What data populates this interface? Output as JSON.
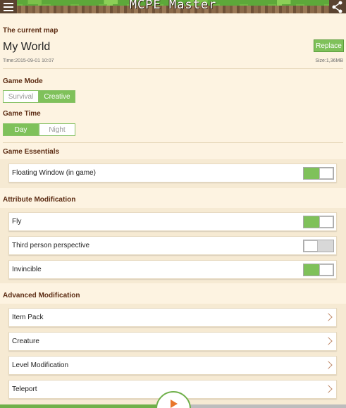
{
  "app": {
    "title": "MCPE Master"
  },
  "current_map": {
    "section_label": "The current map",
    "name": "My World",
    "time": "Time:2015-09-01 10:07",
    "size": "Size:1,36MB",
    "replace_label": "Replace"
  },
  "game_mode": {
    "section_label": "Game Mode",
    "options": [
      "Survival",
      "Creative"
    ],
    "selected": "Creative"
  },
  "game_time": {
    "section_label": "Game Time",
    "options": [
      "Day",
      "Night"
    ],
    "selected": "Day"
  },
  "game_essentials": {
    "section_label": "Game Essentials",
    "items": [
      {
        "label": "Floating Window (in game)",
        "enabled": true
      }
    ]
  },
  "attribute_modification": {
    "section_label": "Attribute Modification",
    "items": [
      {
        "label": "Fly",
        "enabled": true
      },
      {
        "label": "Third person perspective",
        "enabled": false
      },
      {
        "label": "Invincible",
        "enabled": true
      }
    ]
  },
  "advanced_modification": {
    "section_label": "Advanced Modification",
    "items": [
      {
        "label": "Item Pack"
      },
      {
        "label": "Creature"
      },
      {
        "label": "Level Modification"
      },
      {
        "label": "Teleport"
      }
    ]
  },
  "colors": {
    "accent": "#7fc15a",
    "section_title": "#5b2b12",
    "background": "#fdf3e1"
  }
}
